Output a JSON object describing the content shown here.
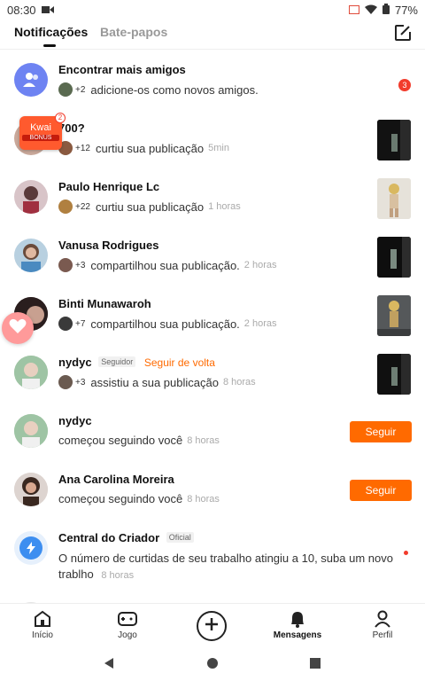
{
  "status": {
    "time": "08:30",
    "battery": "77%"
  },
  "tabs": {
    "notifications": "Notificações",
    "chats": "Bate-papos"
  },
  "notifications": [
    {
      "name": "Encontrar mais amigos",
      "count": "+2",
      "action": "adicione-os como novos amigos.",
      "badge": "3"
    },
    {
      "name": "700?",
      "count": "+12",
      "action": "curtiu sua publicação",
      "time": "5min"
    },
    {
      "name": "Paulo Henrique Lc",
      "count": "+22",
      "action": "curtiu sua publicação",
      "time": "1 horas"
    },
    {
      "name": "Vanusa Rodrigues",
      "count": "+3",
      "action": "compartilhou sua publicação.",
      "time": "2 horas"
    },
    {
      "name": "Binti Munawaroh",
      "count": "+7",
      "action": "compartilhou sua publicação.",
      "time": "2 horas"
    },
    {
      "name": "nydyc",
      "tag": "Seguidor",
      "follow_back": "Seguir de volta",
      "count": "+3",
      "action": "assistiu a sua publicação",
      "time": "8 horas"
    },
    {
      "name": "nydyc",
      "action": "começou seguindo você",
      "time": "8 horas",
      "button": "Seguir"
    },
    {
      "name": "Ana Carolina Moreira",
      "action": "começou seguindo você",
      "time": "8 horas",
      "button": "Seguir"
    },
    {
      "name": "Central do Criador",
      "tag": "Oficial",
      "message": "O número de curtidas de seu trabalho atingiu a 10, suba um novo trablho",
      "time": "8 horas"
    }
  ],
  "kwai_banner": {
    "brand": "Kwai",
    "label": "BONUS",
    "badge": "2"
  },
  "bottom_nav": {
    "home": "Início",
    "game": "Jogo",
    "messages": "Mensagens",
    "profile": "Perfil"
  },
  "colors": {
    "accent": "#ff6a00",
    "badge": "#f23c2c",
    "friends_icon_bg": "#6e83f2",
    "creator_icon_bg": "#3d8ef0"
  }
}
